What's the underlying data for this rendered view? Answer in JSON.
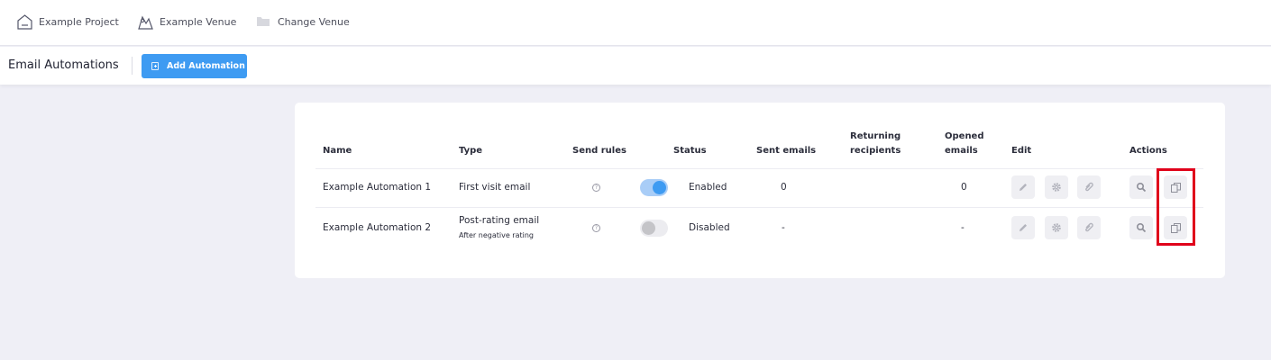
{
  "breadcrumb": {
    "project": "Example Project",
    "venue": "Example Venue",
    "change_venue": "Change Venue"
  },
  "header": {
    "title": "Email Automations",
    "add_button": "Add Automation"
  },
  "table": {
    "columns": {
      "name": "Name",
      "type": "Type",
      "send_rules": "Send rules",
      "status": "Status",
      "sent_emails": "Sent emails",
      "returning_line1": "Returning",
      "returning_line2": "recipients",
      "opened_line1": "Opened",
      "opened_line2": "emails",
      "edit": "Edit",
      "actions": "Actions"
    },
    "rows": [
      {
        "name": "Example Automation 1",
        "type": "First visit email",
        "type_sub": "",
        "enabled": true,
        "status": "Enabled",
        "sent_emails": "0",
        "returning_recipients": "",
        "opened_emails": "0"
      },
      {
        "name": "Example Automation 2",
        "type": "Post-rating email",
        "type_sub": "After negative rating",
        "enabled": false,
        "status": "Disabled",
        "sent_emails": "-",
        "returning_recipients": "",
        "opened_emails": "-"
      }
    ]
  },
  "icons": {
    "help": "?",
    "edit": "pencil-icon",
    "settings": "gear-icon",
    "attachment": "paperclip-icon",
    "view": "magnifier-icon",
    "duplicate": "copy-icon"
  },
  "colors": {
    "accent": "#3e9bf2",
    "highlight": "#e0001b",
    "background": "#efeff6"
  }
}
